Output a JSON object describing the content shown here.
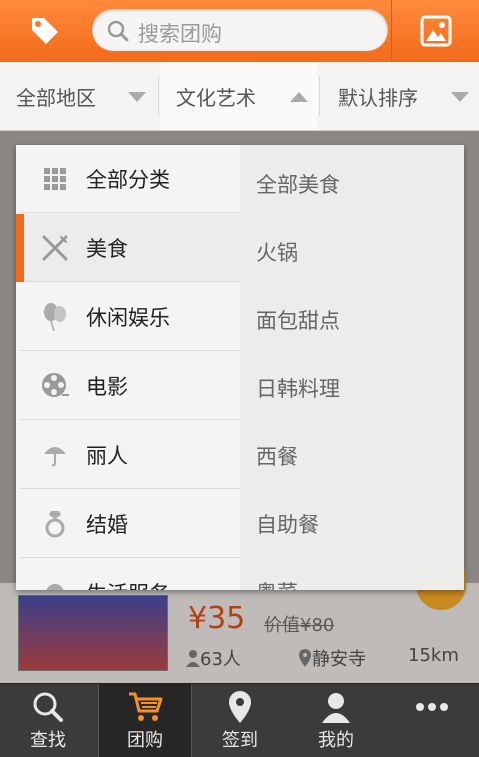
{
  "header": {
    "search_placeholder": "搜索团购"
  },
  "filters": [
    {
      "label": "全部地区"
    },
    {
      "label": "文化艺术"
    },
    {
      "label": "默认排序"
    }
  ],
  "menu": {
    "categories": [
      {
        "label": "全部分类",
        "icon": "grid-icon"
      },
      {
        "label": "美食",
        "icon": "fork-knife-icon",
        "active": true
      },
      {
        "label": "休闲娱乐",
        "icon": "balloon-icon"
      },
      {
        "label": "电影",
        "icon": "film-reel-icon"
      },
      {
        "label": "丽人",
        "icon": "umbrella-icon"
      },
      {
        "label": "结婚",
        "icon": "ring-icon"
      },
      {
        "label": "生活服务",
        "icon": "service-icon"
      }
    ],
    "subcategories": [
      "全部美食",
      "火锅",
      "面包甜点",
      "日韩料理",
      "西餐",
      "自助餐",
      "粤菜"
    ]
  },
  "deal": {
    "price": "¥35",
    "original_price": "价值¥80",
    "people": "63人",
    "location": "静安寺",
    "distance": "15km"
  },
  "tabs": [
    {
      "label": "查找",
      "icon": "search-icon"
    },
    {
      "label": "团购",
      "icon": "cart-icon",
      "active": true
    },
    {
      "label": "签到",
      "icon": "location-pin-icon"
    },
    {
      "label": "我的",
      "icon": "user-icon"
    },
    {
      "label": "",
      "icon": "more-icon"
    }
  ],
  "colors": {
    "accent": "#f26b1a",
    "price": "#b04212"
  }
}
